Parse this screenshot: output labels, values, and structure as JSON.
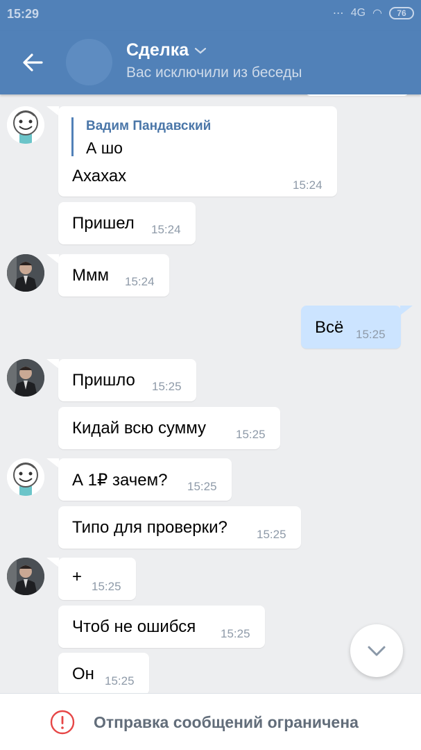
{
  "status": {
    "time": "15:29",
    "network": "4G",
    "battery": "76"
  },
  "header": {
    "title": "Сделка",
    "subtitle": "Вас исключили из беседы"
  },
  "messages": [
    {
      "reply_author": "Вадим Пандавский",
      "reply_text": "А шо",
      "text": "Ахахах",
      "time": "15:24"
    },
    {
      "text": "Пришел",
      "time": "15:24"
    },
    {
      "text": "Ммм",
      "time": "15:24"
    },
    {
      "text": "Всё",
      "time": "15:25"
    },
    {
      "text": "Пришло",
      "time": "15:25"
    },
    {
      "text": "Кидай всю сумму",
      "time": "15:25"
    },
    {
      "text": "А 1₽ зачем?",
      "time": "15:25"
    },
    {
      "text": "Типо для проверки?",
      "time": "15:25"
    },
    {
      "text": "+",
      "time": "15:25"
    },
    {
      "text": "Чтоб не ошибся",
      "time": "15:25"
    },
    {
      "text": "Он",
      "time": "15:25"
    }
  ],
  "footer": {
    "restriction_text": "Отправка сообщений ограничена"
  },
  "colors": {
    "header": "#5181b8",
    "outgoing": "#cce4ff",
    "incoming": "#ffffff",
    "warning": "#e64646"
  }
}
